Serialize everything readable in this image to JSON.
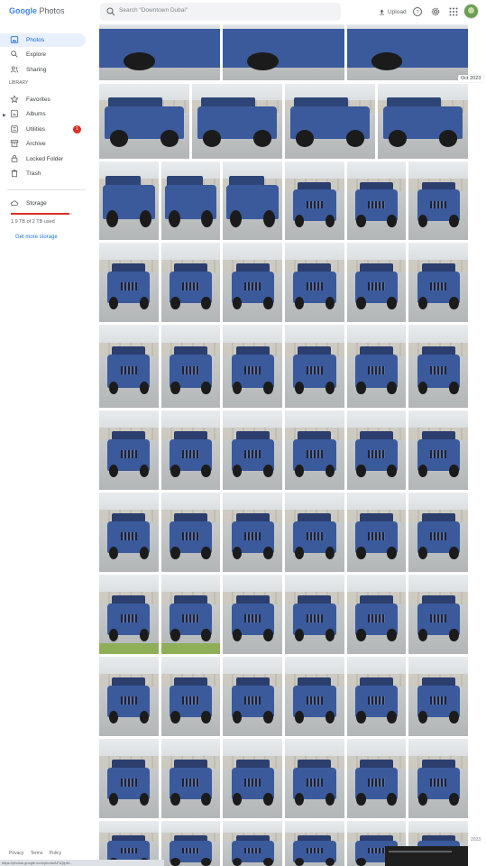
{
  "app": {
    "logo_google": "Google",
    "logo_photos": "Photos",
    "logo_colors": [
      "#4285f4",
      "#ea4335",
      "#fbbc05",
      "#4285f4",
      "#34a853",
      "#ea4335"
    ]
  },
  "search": {
    "placeholder": "Search \"Downtown Dubai\"",
    "icon": "search-icon"
  },
  "topbar": {
    "upload_label": "Upload",
    "icons": [
      "upload-icon",
      "help-icon",
      "settings-icon",
      "apps-icon",
      "avatar"
    ]
  },
  "sidebar": {
    "items": [
      {
        "label": "Photos",
        "icon": "photos-icon",
        "active": true
      },
      {
        "label": "Explore",
        "icon": "search-icon"
      },
      {
        "label": "Sharing",
        "icon": "people-icon"
      }
    ],
    "library_label": "LIBRARY",
    "library": [
      {
        "label": "Favorites",
        "icon": "star-icon"
      },
      {
        "label": "Albums",
        "icon": "albums-icon"
      },
      {
        "label": "Utilities",
        "icon": "utilities-icon",
        "badge": "1"
      },
      {
        "label": "Archive",
        "icon": "archive-icon"
      },
      {
        "label": "Locked Folder",
        "icon": "lock-icon"
      },
      {
        "label": "Trash",
        "icon": "trash-icon"
      }
    ],
    "storage": {
      "label": "Storage",
      "icon": "cloud-icon",
      "used_text": "1.9 TB of 2 TB used",
      "used_fraction": 0.95,
      "bar_color": "#d93025",
      "get_more": "Get more storage"
    },
    "footer": [
      "Privacy",
      "Terms",
      "Policy"
    ]
  },
  "timeline": {
    "date_label": "Oct 2023",
    "year_marker": "2023"
  },
  "photo_rows": [
    [
      {
        "v": "close"
      },
      {
        "v": "close"
      },
      {
        "v": "close"
      }
    ],
    [
      {
        "v": "side"
      },
      {
        "v": "side"
      },
      {
        "v": "side"
      },
      {
        "v": "side"
      }
    ],
    [
      {
        "v": "side"
      },
      {
        "v": "side"
      },
      {
        "v": "side"
      },
      {
        "v": "front"
      },
      {
        "v": "front"
      },
      {
        "v": "front"
      }
    ],
    [
      {
        "v": "front"
      },
      {
        "v": "front"
      },
      {
        "v": "front"
      },
      {
        "v": "front"
      },
      {
        "v": "front"
      },
      {
        "v": "front"
      }
    ],
    [
      {
        "v": "front"
      },
      {
        "v": "front"
      },
      {
        "v": "front"
      },
      {
        "v": "front"
      },
      {
        "v": "front"
      },
      {
        "v": "front"
      }
    ],
    [
      {
        "v": "front"
      },
      {
        "v": "front"
      },
      {
        "v": "front"
      },
      {
        "v": "front"
      },
      {
        "v": "front"
      },
      {
        "v": "front"
      }
    ],
    [
      {
        "v": "front"
      },
      {
        "v": "front"
      },
      {
        "v": "front"
      },
      {
        "v": "front"
      },
      {
        "v": "front"
      },
      {
        "v": "front"
      }
    ],
    [
      {
        "v": "grass"
      },
      {
        "v": "grass"
      },
      {
        "v": "front"
      },
      {
        "v": "front"
      },
      {
        "v": "front"
      },
      {
        "v": "front"
      }
    ],
    [
      {
        "v": "front"
      },
      {
        "v": "front"
      },
      {
        "v": "front"
      },
      {
        "v": "front"
      },
      {
        "v": "front"
      },
      {
        "v": "front"
      }
    ],
    [
      {
        "v": "front"
      },
      {
        "v": "front"
      },
      {
        "v": "front"
      },
      {
        "v": "front"
      },
      {
        "v": "front"
      },
      {
        "v": "front"
      }
    ],
    [
      {
        "v": "front"
      },
      {
        "v": "front"
      },
      {
        "v": "front"
      },
      {
        "v": "front"
      },
      {
        "v": "front"
      },
      {
        "v": "front"
      }
    ]
  ],
  "status_url": "https://photos.google.com/photo/AF1QipM..."
}
